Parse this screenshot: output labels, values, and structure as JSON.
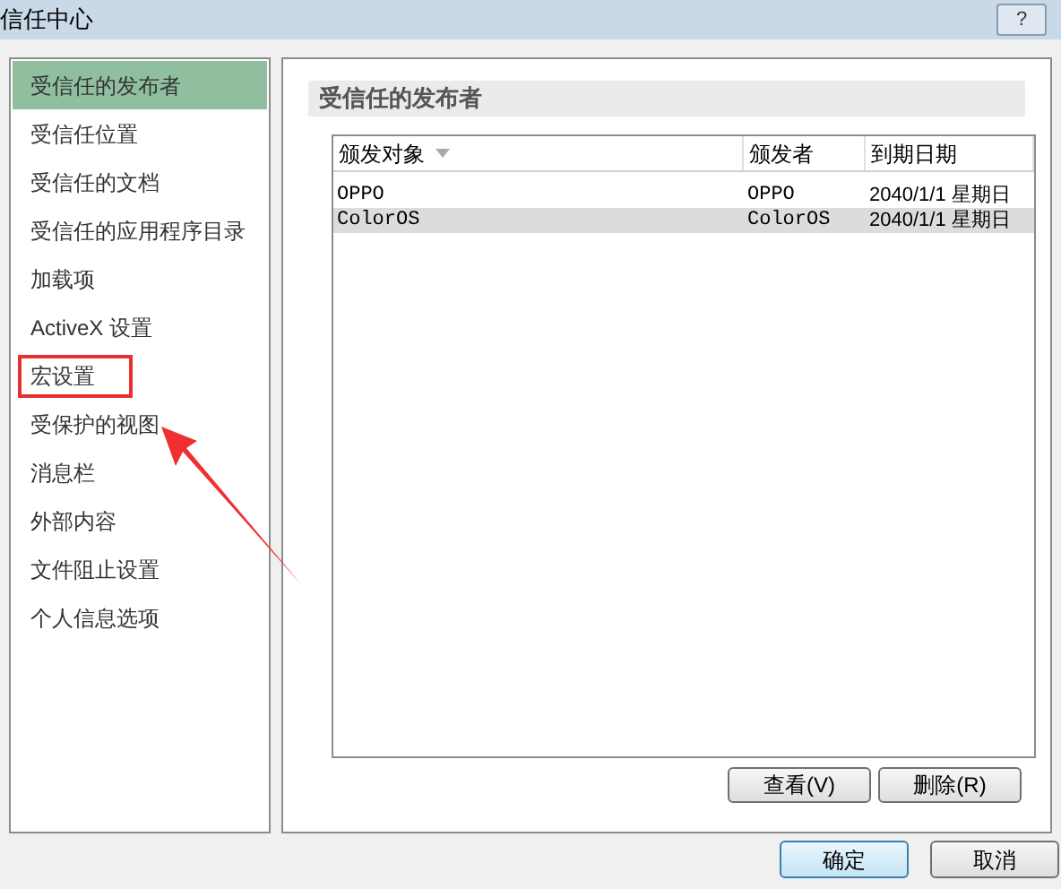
{
  "window": {
    "title": "信任中心",
    "help_button": "?"
  },
  "sidebar": {
    "items": [
      {
        "label": "受信任的发布者",
        "selected": true
      },
      {
        "label": "受信任位置",
        "selected": false
      },
      {
        "label": "受信任的文档",
        "selected": false
      },
      {
        "label": "受信任的应用程序目录",
        "selected": false
      },
      {
        "label": "加载项",
        "selected": false
      },
      {
        "label": "ActiveX 设置",
        "selected": false
      },
      {
        "label": "宏设置",
        "selected": false
      },
      {
        "label": "受保护的视图",
        "selected": false
      },
      {
        "label": "消息栏",
        "selected": false
      },
      {
        "label": "外部内容",
        "selected": false
      },
      {
        "label": "文件阻止设置",
        "selected": false
      },
      {
        "label": "个人信息选项",
        "selected": false
      }
    ]
  },
  "section": {
    "title": "受信任的发布者"
  },
  "table": {
    "columns": [
      "颁发对象",
      "颁发者",
      "到期日期"
    ],
    "rows": [
      {
        "cells": [
          "OPPO",
          "OPPO",
          "2040/1/1 星期日"
        ],
        "selected": false
      },
      {
        "cells": [
          "ColorOS",
          "ColorOS",
          "2040/1/1 星期日"
        ],
        "selected": true
      }
    ]
  },
  "table_buttons": [
    "查看(V)",
    "删除(R)"
  ],
  "dialog_buttons": [
    {
      "label": "确定",
      "default": true
    },
    {
      "label": "取消",
      "default": false
    }
  ]
}
